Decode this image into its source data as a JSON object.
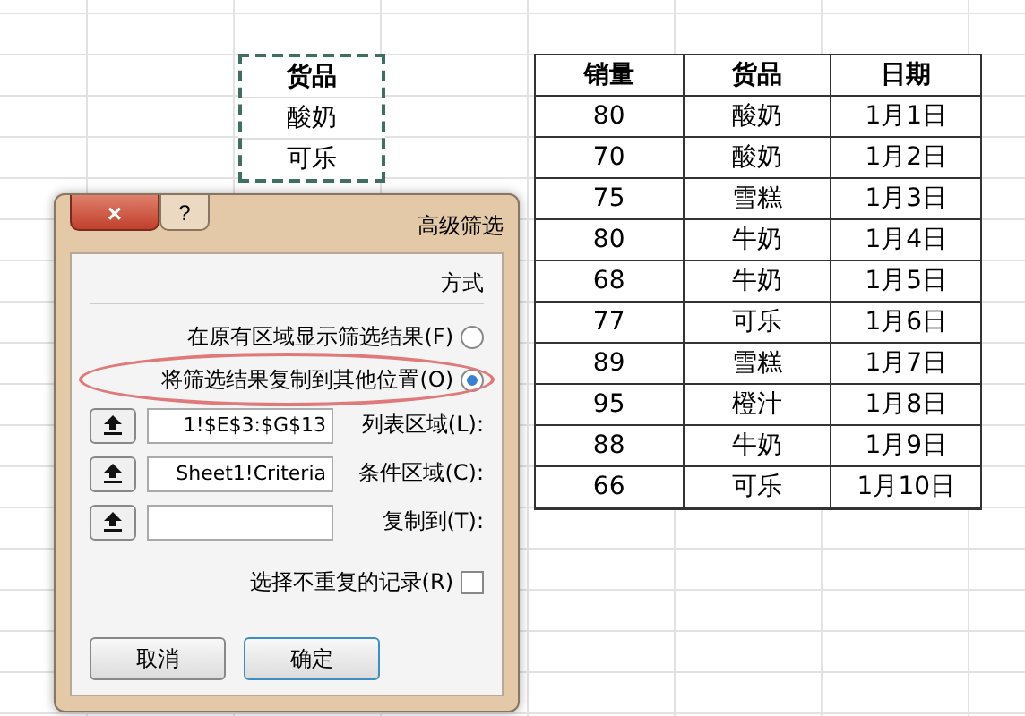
{
  "criteria": {
    "header": "货品",
    "values": [
      "酸奶",
      "可乐"
    ]
  },
  "table": {
    "columns": [
      "销量",
      "货品",
      "日期"
    ],
    "rows": [
      [
        "80",
        "酸奶",
        "1月1日"
      ],
      [
        "70",
        "酸奶",
        "1月2日"
      ],
      [
        "75",
        "雪糕",
        "1月3日"
      ],
      [
        "80",
        "牛奶",
        "1月4日"
      ],
      [
        "68",
        "牛奶",
        "1月5日"
      ],
      [
        "77",
        "可乐",
        "1月6日"
      ],
      [
        "89",
        "雪糕",
        "1月7日"
      ],
      [
        "95",
        "橙汁",
        "1月8日"
      ],
      [
        "88",
        "牛奶",
        "1月9日"
      ],
      [
        "66",
        "可乐",
        "1月10日"
      ]
    ]
  },
  "dialog": {
    "title": "高级筛选",
    "help": "?",
    "close": "×",
    "section": "方式",
    "options": [
      {
        "label": "在原有区域显示筛选结果(F)",
        "selected": false,
        "highlighted": false
      },
      {
        "label": "将筛选结果复制到其他位置(O)",
        "selected": true,
        "highlighted": true
      }
    ],
    "fields": [
      {
        "label": "列表区域(L):",
        "value": "1!$E$3:$G$13"
      },
      {
        "label": "条件区域(C):",
        "value": "Sheet1!Criteria"
      },
      {
        "label": "复制到(T):"
      }
    ],
    "unique": {
      "label": "选择不重复的记录(R)",
      "checked": false
    },
    "buttons": [
      {
        "label": "取消",
        "default": false
      },
      {
        "label": "确定",
        "default": true
      }
    ]
  }
}
